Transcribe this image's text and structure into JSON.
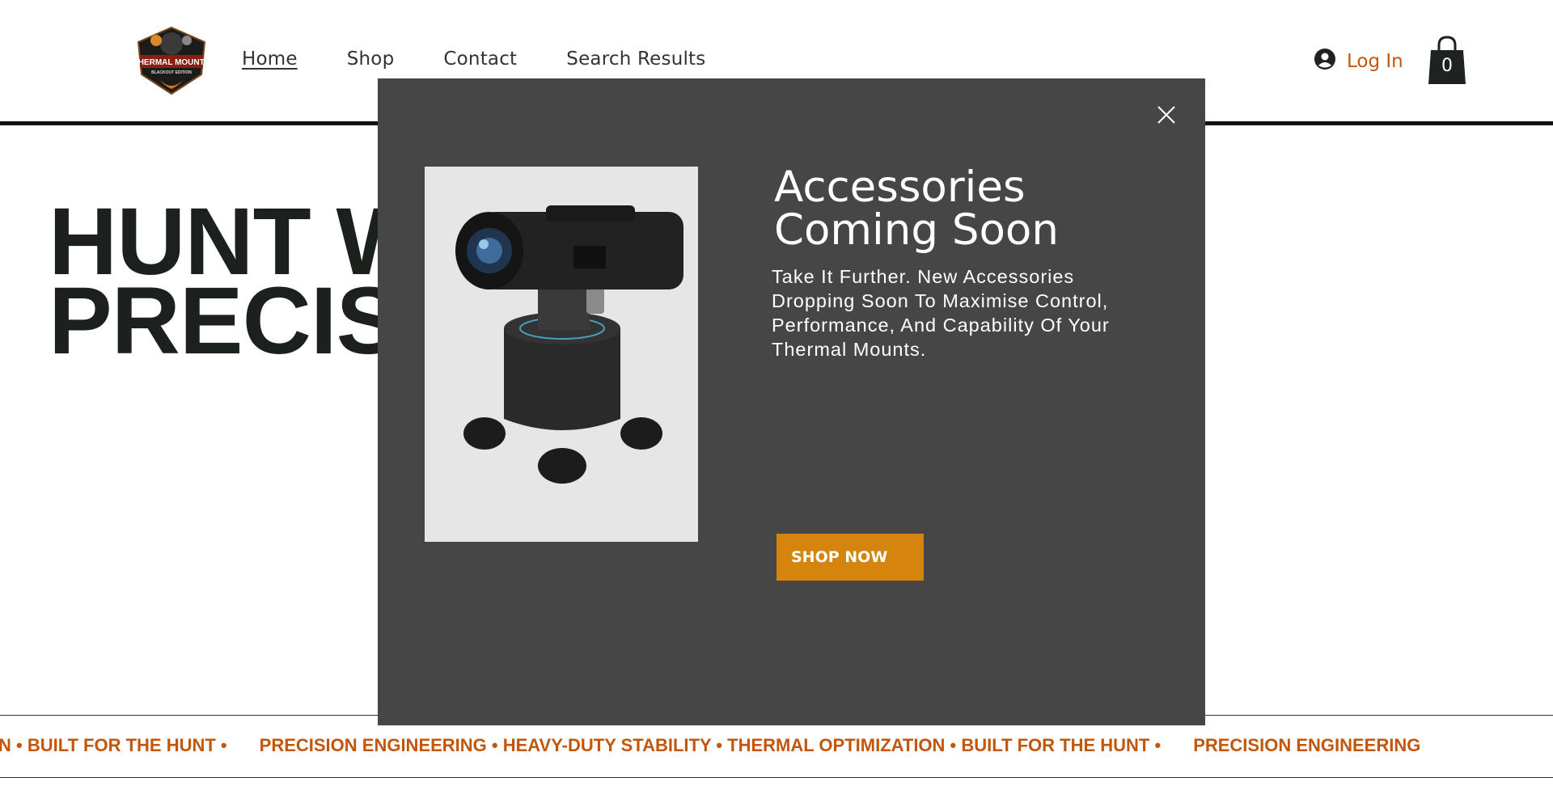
{
  "header": {
    "logo": {
      "text_main": "THERMAL MOUNTS",
      "text_sub": "BLACKOUT EDITION"
    },
    "nav": [
      {
        "label": "Home",
        "active": true
      },
      {
        "label": "Shop",
        "active": false
      },
      {
        "label": "Contact",
        "active": false
      },
      {
        "label": "Search Results",
        "active": false
      }
    ],
    "login_label": "Log In",
    "cart_count": "0",
    "icons": {
      "login": "user-avatar-icon",
      "cart": "shopping-bag-icon"
    }
  },
  "hero": {
    "line1": "HUNT WI",
    "line2": "PRECISIO"
  },
  "ticker": {
    "items": [
      "N • BUILT FOR THE HUNT •",
      "PRECISION ENGINEERING • HEAVY-DUTY STABILITY • THERMAL OPTIMIZATION • BUILT FOR THE HUNT •",
      "PRECISION ENGINEERING"
    ]
  },
  "modal": {
    "title_line1": "Accessories",
    "title_line2": "Coming Soon",
    "body": "Take It Further. New Accessories Dropping Soon To Maximise Control, Performance, And Capability Of Your Thermal Mounts.",
    "cta_label": "SHOP NOW",
    "close_icon": "close-icon"
  },
  "colors": {
    "accent": "#c2570c",
    "cta": "#d4850d",
    "modal_bg": "#464646",
    "hero_text": "#1d211e"
  }
}
